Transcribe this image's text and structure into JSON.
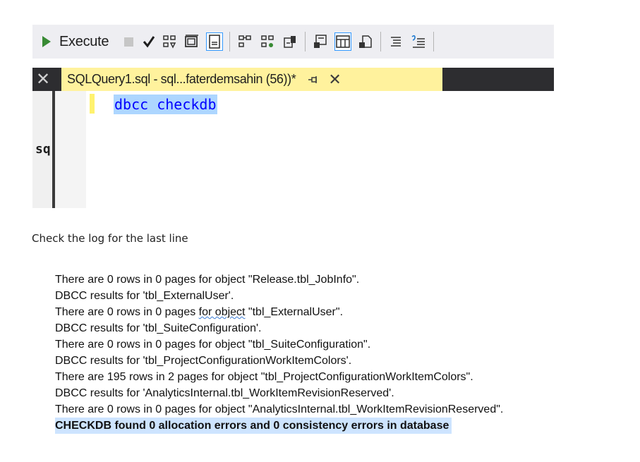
{
  "toolbar": {
    "execute_label": "Execute",
    "icons": [
      "display-estimated-plan-icon",
      "results-to-text-icon",
      "results-to-grid-icon",
      "results-to-file-icon",
      "include-actual-plan-icon",
      "include-client-stats-icon",
      "comment-icon",
      "uncomment-icon"
    ]
  },
  "tab": {
    "title": "SQLQuery1.sql - sql...faterdemsahin (56))*",
    "pin_icon": "pin-icon",
    "close_icon": "close-icon"
  },
  "side_panel": {
    "text": "sq"
  },
  "editor": {
    "code": "dbcc checkdb"
  },
  "caption": "Check the log for the last line",
  "log": {
    "lines": [
      "There are 0 rows in 0 pages for object \"Release.tbl_JobInfo\".",
      "DBCC results for 'tbl_ExternalUser'.",
      "There are 0 rows in 0 pages for object \"tbl_ExternalUser\".",
      "DBCC results for 'tbl_SuiteConfiguration'.",
      "There are 0 rows in 0 pages for object \"tbl_SuiteConfiguration\".",
      "DBCC results for 'tbl_ProjectConfigurationWorkItemColors'.",
      "There are 195 rows in 2 pages for object \"tbl_ProjectConfigurationWorkItemColors\".",
      "DBCC results for 'AnalyticsInternal.tbl_WorkItemRevisionReserved'.",
      "There are 0 rows in 0 pages for object \"AnalyticsInternal.tbl_WorkItemRevisionReserved\"."
    ],
    "final_line": "CHECKDB found 0 allocation errors and 0 consistency errors in database"
  },
  "colors": {
    "toolbar_bg": "#eeeef2",
    "tabstrip_bg": "#2d2d30",
    "active_tab_bg": "#fff29d",
    "selection": "#add6ff",
    "keyword": "#0000ff",
    "final_highlight": "#cde4ff"
  }
}
